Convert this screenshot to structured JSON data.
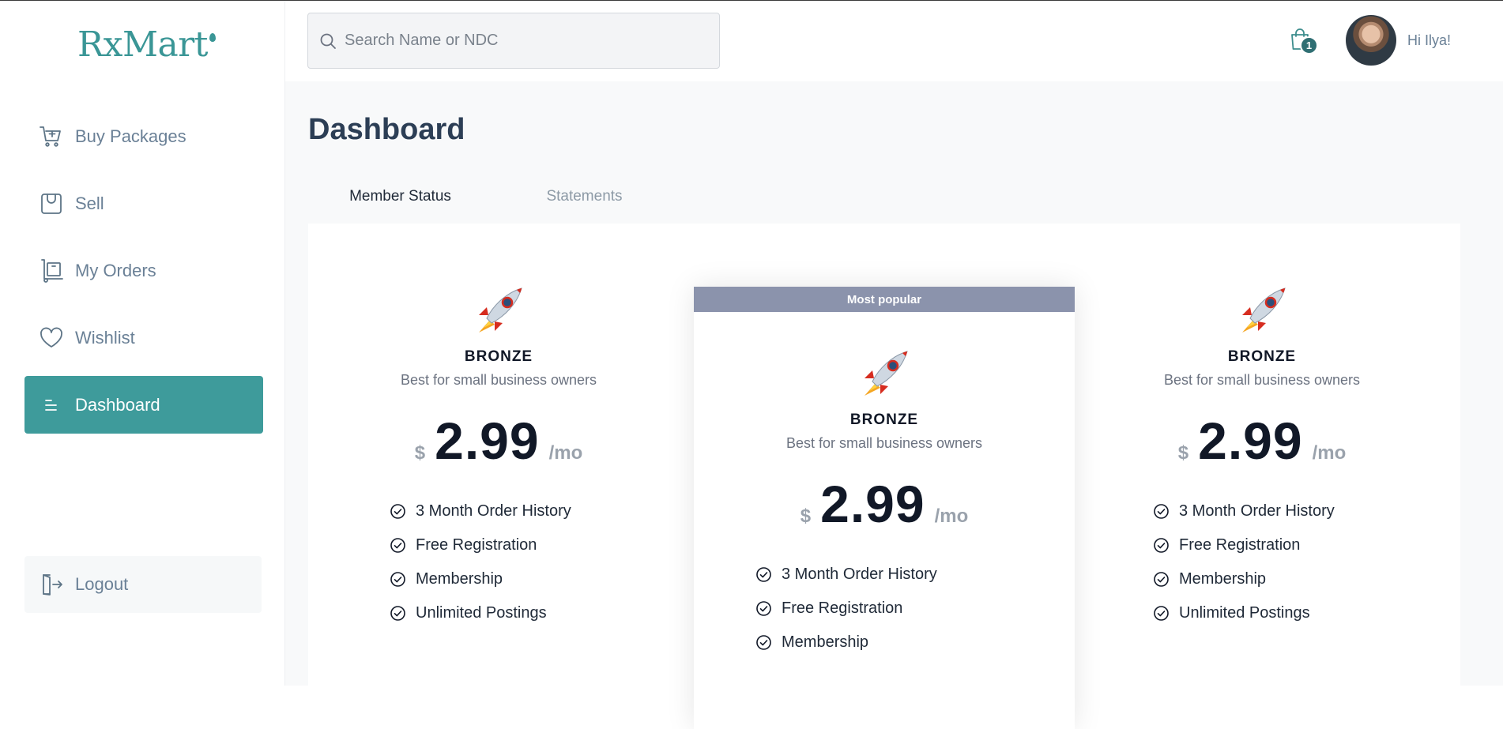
{
  "app": {
    "logo_text": "RxMart"
  },
  "sidebar": {
    "items": [
      {
        "label": "Buy Packages",
        "icon": "cart-plus-icon"
      },
      {
        "label": "Sell",
        "icon": "bag-icon"
      },
      {
        "label": "My Orders",
        "icon": "trolley-box-icon"
      },
      {
        "label": "Wishlist",
        "icon": "heart-icon"
      },
      {
        "label": "Dashboard",
        "icon": "menu-lines-icon",
        "active": true
      }
    ],
    "logout_label": "Logout"
  },
  "header": {
    "search_placeholder": "Search Name or NDC",
    "cart_count": "1",
    "greeting": "Hi Ilya!"
  },
  "main": {
    "title": "Dashboard",
    "tabs": [
      {
        "label": "Member Status",
        "active": true
      },
      {
        "label": "Statements",
        "active": false
      }
    ]
  },
  "plans": [
    {
      "tier": "BRONZE",
      "description": "Best for small business owners",
      "currency": "$",
      "price": "2.99",
      "period": "/mo",
      "features": [
        "3 Month Order History",
        "Free Registration",
        "Membership",
        "Unlimited Postings"
      ]
    },
    {
      "badge": "Most popular",
      "tier": "BRONZE",
      "description": "Best for small business owners",
      "currency": "$",
      "price": "2.99",
      "period": "/mo",
      "features": [
        "3 Month Order History",
        "Free Registration",
        "Membership"
      ]
    },
    {
      "tier": "BRONZE",
      "description": "Best for small business owners",
      "currency": "$",
      "price": "2.99",
      "period": "/mo",
      "features": [
        "3 Month Order History",
        "Free Registration",
        "Membership",
        "Unlimited Postings"
      ]
    }
  ],
  "colors": {
    "accent": "#3e9b9b",
    "popular_banner": "#8b93ac",
    "nav_text": "#6a8096"
  }
}
